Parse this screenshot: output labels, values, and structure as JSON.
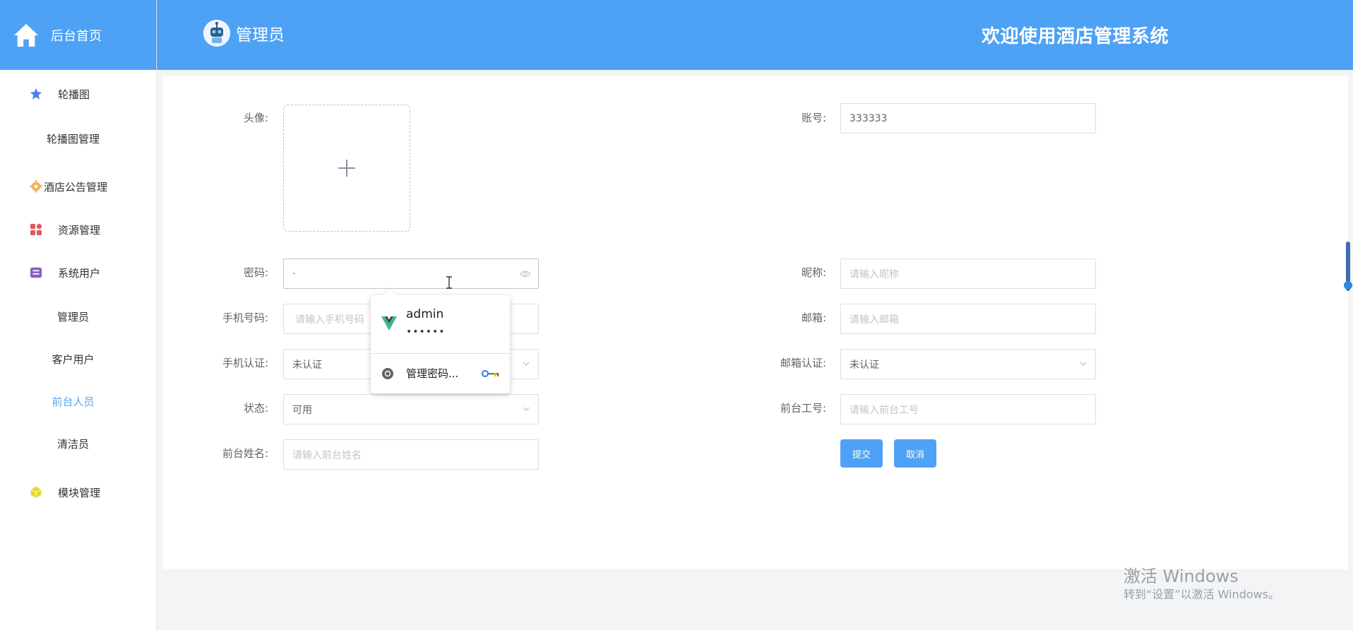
{
  "sidebar": {
    "home_label": "后台首页",
    "menu": [
      {
        "label": "轮播图",
        "icon": "star-icon"
      },
      {
        "label": "轮播图管理"
      },
      {
        "label": "酒店公告管理",
        "icon": "gear-icon"
      },
      {
        "label": "资源管理",
        "icon": "grid-icon"
      },
      {
        "label": "系统用户",
        "icon": "box-icon"
      },
      {
        "label": "管理员"
      },
      {
        "label": "客户用户"
      },
      {
        "label": "前台人员",
        "active": true
      },
      {
        "label": "清洁员"
      },
      {
        "label": "模块管理",
        "icon": "cube-icon"
      }
    ]
  },
  "header": {
    "role": "管理员",
    "welcome": "欢迎使用酒店管理系统",
    "color": "#4ea2f5"
  },
  "form": {
    "avatar_label": "头像:",
    "account_label": "账号:",
    "account_value": "333333",
    "password_label": "密码:",
    "password_value": "·",
    "nickname_label": "昵称:",
    "nickname_placeholder": "请输入昵称",
    "phone_label": "手机号码:",
    "phone_placeholder": "请输入手机号码",
    "email_label": "邮箱:",
    "email_placeholder": "请输入邮箱",
    "phone_verify_label": "手机认证:",
    "phone_verify_value": "未认证",
    "email_verify_label": "邮箱认证:",
    "email_verify_value": "未认证",
    "status_label": "状态:",
    "status_value": "可用",
    "staff_no_label": "前台工号:",
    "staff_no_placeholder": "请输入前台工号",
    "staff_name_label": "前台姓名:",
    "staff_name_placeholder": "请输入前台姓名",
    "submit": "提交",
    "cancel": "取消"
  },
  "autofill": {
    "username": "admin",
    "password_mask": "••••••",
    "manage": "管理密码..."
  },
  "watermark": {
    "line1": "激活 Windows",
    "line2": "转到“设置”以激活 Windows。"
  }
}
